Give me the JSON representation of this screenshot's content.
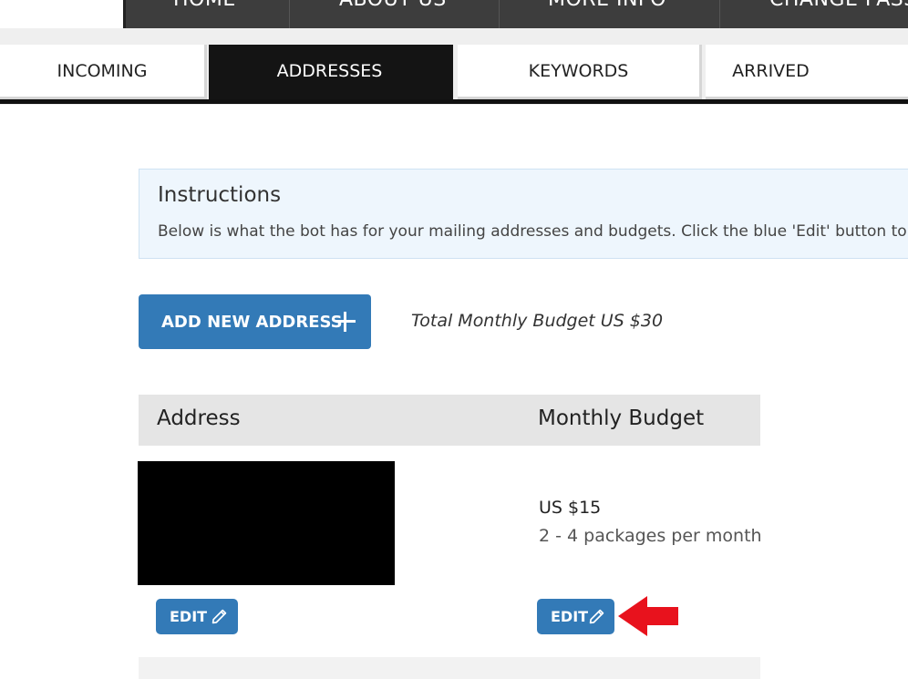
{
  "topnav": {
    "items": [
      {
        "label": "HOME"
      },
      {
        "label": "ABOUT US"
      },
      {
        "label": "MORE INFO"
      },
      {
        "label": "CHANGE PASS"
      }
    ]
  },
  "tabs": [
    {
      "label": "INCOMING",
      "active": false
    },
    {
      "label": "ADDRESSES",
      "active": true
    },
    {
      "label": "KEYWORDS",
      "active": false
    },
    {
      "label": "ARRIVED",
      "active": false
    }
  ],
  "instructions": {
    "title": "Instructions",
    "text": "Below is what the bot has for your mailing addresses and budgets. Click the blue 'Edit' button to upda"
  },
  "actions": {
    "add_address_label": "ADD NEW ADDRESS",
    "total_budget": "Total Monthly Budget US $30"
  },
  "table": {
    "headers": {
      "address": "Address",
      "budget": "Monthly Budget"
    },
    "rows": [
      {
        "address_redacted": true,
        "budget": "US $15",
        "packages": "2 - 4 packages per month",
        "edit_address_label": "EDIT",
        "edit_budget_label": "EDIT"
      }
    ]
  },
  "icons": {
    "plus": "plus-icon",
    "pencil": "pencil-icon",
    "annotation": "red-arrow-icon"
  },
  "colors": {
    "primary": "#337ab7",
    "nav_dark": "#3d3d3d",
    "active_tab": "#141414",
    "arrow": "#e8121d",
    "instructions_bg": "#eef6fd"
  }
}
